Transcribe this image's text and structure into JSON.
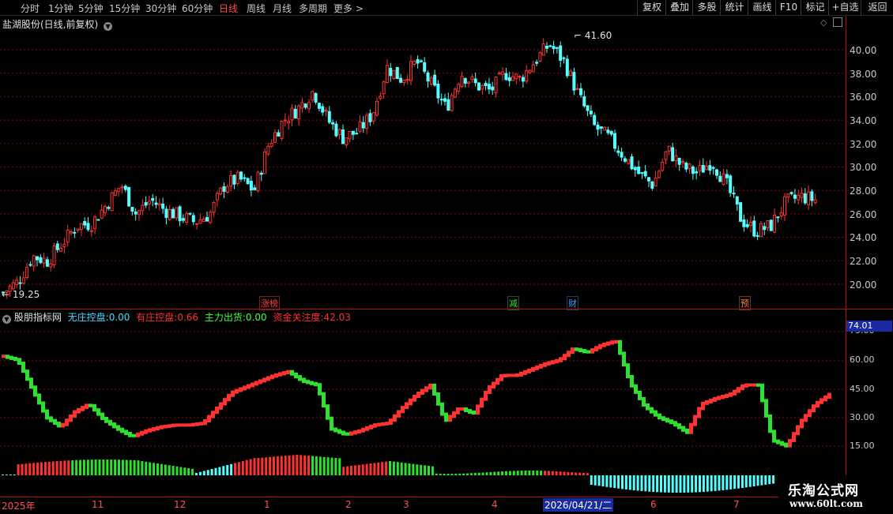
{
  "toolbar": {
    "periods": [
      "分时",
      "1分钟",
      "5分钟",
      "15分钟",
      "30分钟",
      "60分钟",
      "日线",
      "周线",
      "月线",
      "多周期",
      "更多 >"
    ],
    "active_period": "日线",
    "right_buttons": [
      "复权",
      "叠加",
      "多股",
      "统计",
      "画线",
      "F10",
      "标记",
      "+自选",
      "返回"
    ]
  },
  "main_chart": {
    "title": "盐湖股份(日线,前复权)",
    "y_ticks": [
      "40.00",
      "38.00",
      "36.00",
      "34.00",
      "32.00",
      "30.00",
      "28.00",
      "26.00",
      "24.00",
      "22.00",
      "20.00"
    ],
    "high_label": "41.60",
    "low_label": "19.25",
    "event_tags": [
      {
        "text": "涨榜",
        "color": "#ff4040"
      },
      {
        "text": "减",
        "color": "#40e040"
      },
      {
        "text": "财",
        "color": "#40a0ff"
      },
      {
        "text": "预",
        "color": "#ff8040"
      }
    ]
  },
  "indicator": {
    "name": "股朋指标网",
    "items": [
      {
        "label": "无庄控盘:",
        "value": "0.00",
        "color": "#4fd8ff"
      },
      {
        "label": "有庄控盘:",
        "value": "0.66",
        "color": "#ff3030"
      },
      {
        "label": "主力出货:",
        "value": "0.00",
        "color": "#40ff40"
      },
      {
        "label": "资金关注度:",
        "value": "42.03",
        "color": "#ff3030"
      }
    ],
    "y_ticks": [
      "75.00",
      "60.00",
      "45.00",
      "30.00",
      "15.00"
    ],
    "current_value": "74.01"
  },
  "date_axis": {
    "labels": [
      "2025年",
      "11",
      "12",
      "1",
      "2",
      "3",
      "4",
      "2026/04/21/二",
      "6",
      "7"
    ],
    "highlight": "2026/04/21/二"
  },
  "watermark": {
    "line1": "乐淘公式网",
    "line2": "www.60lt.com"
  },
  "colors": {
    "up": "#ff3232",
    "down": "#54ffff",
    "green": "#30e030",
    "grid": "#7a1010",
    "axis": "#b01010"
  },
  "chart_data": {
    "type": "candlestick",
    "series_close_approx": [
      19.3,
      20.2,
      22.4,
      22.0,
      23.5,
      25.0,
      25.2,
      26.8,
      28.5,
      26.0,
      27.2,
      26.3,
      25.8,
      25.3,
      26.0,
      28.5,
      29.0,
      28.0,
      32.0,
      34.0,
      35.0,
      36.5,
      34.0,
      32.5,
      33.0,
      34.5,
      38.5,
      37.5,
      39.0,
      37.0,
      35.0,
      38.0,
      37.0,
      36.5,
      38.0,
      37.5,
      39.0,
      40.5,
      39.0,
      36.0,
      33.5,
      32.5,
      31.0,
      29.5,
      28.5,
      31.5,
      30.0,
      29.5,
      30.5,
      28.5,
      25.5,
      24.5,
      25.0,
      27.0,
      27.5,
      27.2
    ],
    "indicator_line_approx": [
      62,
      60,
      45,
      30,
      25,
      33,
      37,
      29,
      24,
      20,
      23,
      25,
      26,
      26,
      27,
      35,
      43,
      46,
      49,
      52,
      54,
      49,
      47,
      24,
      21,
      23,
      26,
      27,
      35,
      42,
      47,
      28,
      35,
      32,
      45,
      52,
      52,
      55,
      58,
      60,
      66,
      64,
      68,
      70,
      48,
      36,
      30,
      27,
      22,
      37,
      40,
      42,
      47,
      47,
      18,
      15,
      28,
      37,
      42
    ]
  }
}
